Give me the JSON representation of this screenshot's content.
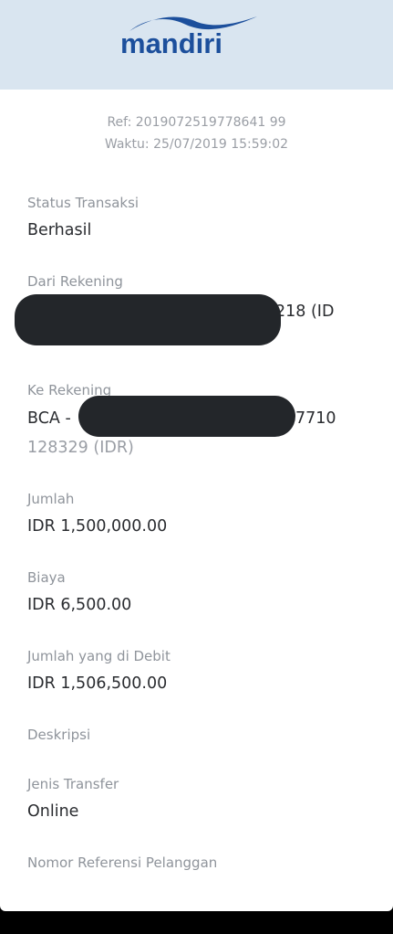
{
  "brand": {
    "name": "mandiri",
    "color": "#1c4f9c",
    "header_bg": "#d9e5f0"
  },
  "reference": {
    "ref_line": "Ref: 2019072519778641 99",
    "time_line": "Waktu: 25/07/2019 15:59:02"
  },
  "fields": {
    "status": {
      "label": "Status Transaksi",
      "value": "Berhasil"
    },
    "from_account": {
      "label": "Dari Rekening",
      "visible_tail": "218 (ID"
    },
    "to_account": {
      "label": "Ke Rekening",
      "prefix": "BCA -",
      "tail_line1": "7710",
      "line2": "128329 (IDR)"
    },
    "amount": {
      "label": "Jumlah",
      "value": "IDR 1,500,000.00"
    },
    "fee": {
      "label": "Biaya",
      "value": "IDR 6,500.00"
    },
    "debited": {
      "label": "Jumlah yang di Debit",
      "value": "IDR 1,506,500.00"
    },
    "description": {
      "label": "Deskripsi"
    },
    "transfer_type": {
      "label": "Jenis Transfer",
      "value": "Online"
    },
    "customer_ref": {
      "label": "Nomor Referensi Pelanggan"
    }
  }
}
